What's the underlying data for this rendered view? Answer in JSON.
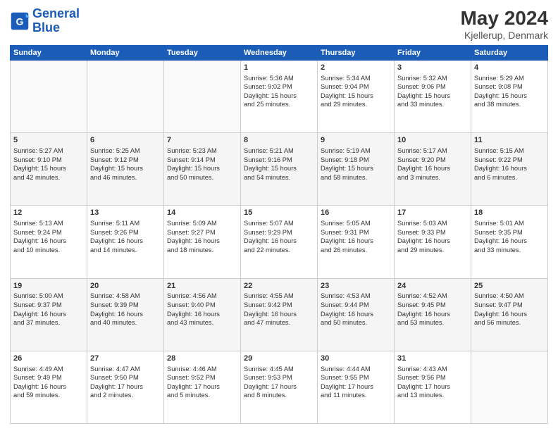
{
  "header": {
    "logo_general": "General",
    "logo_blue": "Blue",
    "month_year": "May 2024",
    "location": "Kjellerup, Denmark"
  },
  "days_of_week": [
    "Sunday",
    "Monday",
    "Tuesday",
    "Wednesday",
    "Thursday",
    "Friday",
    "Saturday"
  ],
  "weeks": [
    [
      {
        "day": "",
        "info": ""
      },
      {
        "day": "",
        "info": ""
      },
      {
        "day": "",
        "info": ""
      },
      {
        "day": "1",
        "info": "Sunrise: 5:36 AM\nSunset: 9:02 PM\nDaylight: 15 hours\nand 25 minutes."
      },
      {
        "day": "2",
        "info": "Sunrise: 5:34 AM\nSunset: 9:04 PM\nDaylight: 15 hours\nand 29 minutes."
      },
      {
        "day": "3",
        "info": "Sunrise: 5:32 AM\nSunset: 9:06 PM\nDaylight: 15 hours\nand 33 minutes."
      },
      {
        "day": "4",
        "info": "Sunrise: 5:29 AM\nSunset: 9:08 PM\nDaylight: 15 hours\nand 38 minutes."
      }
    ],
    [
      {
        "day": "5",
        "info": "Sunrise: 5:27 AM\nSunset: 9:10 PM\nDaylight: 15 hours\nand 42 minutes."
      },
      {
        "day": "6",
        "info": "Sunrise: 5:25 AM\nSunset: 9:12 PM\nDaylight: 15 hours\nand 46 minutes."
      },
      {
        "day": "7",
        "info": "Sunrise: 5:23 AM\nSunset: 9:14 PM\nDaylight: 15 hours\nand 50 minutes."
      },
      {
        "day": "8",
        "info": "Sunrise: 5:21 AM\nSunset: 9:16 PM\nDaylight: 15 hours\nand 54 minutes."
      },
      {
        "day": "9",
        "info": "Sunrise: 5:19 AM\nSunset: 9:18 PM\nDaylight: 15 hours\nand 58 minutes."
      },
      {
        "day": "10",
        "info": "Sunrise: 5:17 AM\nSunset: 9:20 PM\nDaylight: 16 hours\nand 3 minutes."
      },
      {
        "day": "11",
        "info": "Sunrise: 5:15 AM\nSunset: 9:22 PM\nDaylight: 16 hours\nand 6 minutes."
      }
    ],
    [
      {
        "day": "12",
        "info": "Sunrise: 5:13 AM\nSunset: 9:24 PM\nDaylight: 16 hours\nand 10 minutes."
      },
      {
        "day": "13",
        "info": "Sunrise: 5:11 AM\nSunset: 9:26 PM\nDaylight: 16 hours\nand 14 minutes."
      },
      {
        "day": "14",
        "info": "Sunrise: 5:09 AM\nSunset: 9:27 PM\nDaylight: 16 hours\nand 18 minutes."
      },
      {
        "day": "15",
        "info": "Sunrise: 5:07 AM\nSunset: 9:29 PM\nDaylight: 16 hours\nand 22 minutes."
      },
      {
        "day": "16",
        "info": "Sunrise: 5:05 AM\nSunset: 9:31 PM\nDaylight: 16 hours\nand 26 minutes."
      },
      {
        "day": "17",
        "info": "Sunrise: 5:03 AM\nSunset: 9:33 PM\nDaylight: 16 hours\nand 29 minutes."
      },
      {
        "day": "18",
        "info": "Sunrise: 5:01 AM\nSunset: 9:35 PM\nDaylight: 16 hours\nand 33 minutes."
      }
    ],
    [
      {
        "day": "19",
        "info": "Sunrise: 5:00 AM\nSunset: 9:37 PM\nDaylight: 16 hours\nand 37 minutes."
      },
      {
        "day": "20",
        "info": "Sunrise: 4:58 AM\nSunset: 9:39 PM\nDaylight: 16 hours\nand 40 minutes."
      },
      {
        "day": "21",
        "info": "Sunrise: 4:56 AM\nSunset: 9:40 PM\nDaylight: 16 hours\nand 43 minutes."
      },
      {
        "day": "22",
        "info": "Sunrise: 4:55 AM\nSunset: 9:42 PM\nDaylight: 16 hours\nand 47 minutes."
      },
      {
        "day": "23",
        "info": "Sunrise: 4:53 AM\nSunset: 9:44 PM\nDaylight: 16 hours\nand 50 minutes."
      },
      {
        "day": "24",
        "info": "Sunrise: 4:52 AM\nSunset: 9:45 PM\nDaylight: 16 hours\nand 53 minutes."
      },
      {
        "day": "25",
        "info": "Sunrise: 4:50 AM\nSunset: 9:47 PM\nDaylight: 16 hours\nand 56 minutes."
      }
    ],
    [
      {
        "day": "26",
        "info": "Sunrise: 4:49 AM\nSunset: 9:49 PM\nDaylight: 16 hours\nand 59 minutes."
      },
      {
        "day": "27",
        "info": "Sunrise: 4:47 AM\nSunset: 9:50 PM\nDaylight: 17 hours\nand 2 minutes."
      },
      {
        "day": "28",
        "info": "Sunrise: 4:46 AM\nSunset: 9:52 PM\nDaylight: 17 hours\nand 5 minutes."
      },
      {
        "day": "29",
        "info": "Sunrise: 4:45 AM\nSunset: 9:53 PM\nDaylight: 17 hours\nand 8 minutes."
      },
      {
        "day": "30",
        "info": "Sunrise: 4:44 AM\nSunset: 9:55 PM\nDaylight: 17 hours\nand 11 minutes."
      },
      {
        "day": "31",
        "info": "Sunrise: 4:43 AM\nSunset: 9:56 PM\nDaylight: 17 hours\nand 13 minutes."
      },
      {
        "day": "",
        "info": ""
      }
    ]
  ]
}
